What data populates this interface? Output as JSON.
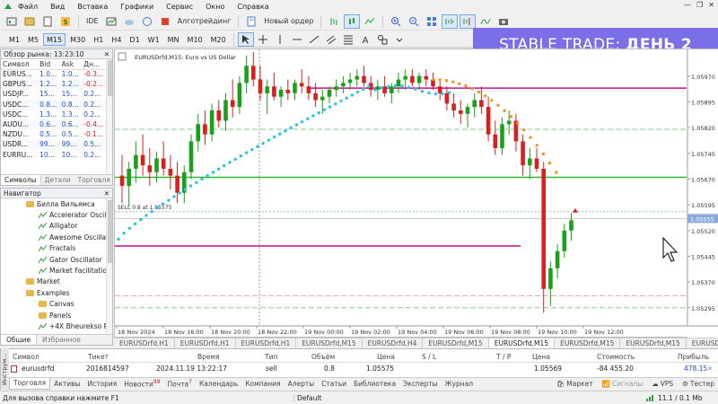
{
  "menu": [
    "Файл",
    "Вид",
    "Вставка",
    "Графики",
    "Сервис",
    "Окно",
    "Справка"
  ],
  "toolbar": {
    "ide": "IDE",
    "algo": "Алготрейдинг",
    "new_order": "Новый ордер"
  },
  "timeframes": [
    "M1",
    "M5",
    "M15",
    "M30",
    "H1",
    "H4",
    "D1",
    "W1",
    "MN",
    "M10",
    "M20"
  ],
  "selected_timeframe": "M15",
  "banner": {
    "prefix": "STABLE TRADE:",
    "bold": "ДЕНЬ 2",
    "bg": "#7a6fe6"
  },
  "market_watch": {
    "title": "Обзор рынка: 13:23:10",
    "headers": [
      "Символ",
      "Bid",
      "Ask",
      "Дн..."
    ],
    "rows": [
      {
        "sym": "EURUS...",
        "bid": "1.0...",
        "ask": "1.0...",
        "chg": "-0.3..."
      },
      {
        "sym": "GBPUS...",
        "bid": "1.2...",
        "ask": "1.2...",
        "chg": "-0.2..."
      },
      {
        "sym": "USDJP...",
        "bid": "15...",
        "ask": "15...",
        "chg": "0.2..."
      },
      {
        "sym": "USDC...",
        "bid": "0.8...",
        "ask": "0.8...",
        "chg": "0.2..."
      },
      {
        "sym": "USDC...",
        "bid": "1.3...",
        "ask": "1.3...",
        "chg": "0.2..."
      },
      {
        "sym": "AUDU...",
        "bid": "0.6...",
        "ask": "0.6...",
        "chg": "-0.4..."
      },
      {
        "sym": "NZDU...",
        "bid": "0.5...",
        "ask": "0.5...",
        "chg": "-0.1..."
      },
      {
        "sym": "USDR...",
        "bid": "99...",
        "ask": "99...",
        "chg": "0.5..."
      },
      {
        "sym": "EURRU...",
        "bid": "10...",
        "ask": "10...",
        "chg": "0.2..."
      }
    ],
    "tabs": [
      "Символы",
      "Детали",
      "Торговля"
    ]
  },
  "navigator": {
    "title": "Навигатор",
    "items": [
      {
        "label": "Билла Вильямса",
        "type": "folder",
        "indent": 28
      },
      {
        "label": "Accelerator Oscill",
        "type": "ind",
        "indent": 42
      },
      {
        "label": "Alligator",
        "type": "ind",
        "indent": 42
      },
      {
        "label": "Awesome Oscillat",
        "type": "ind",
        "indent": 42
      },
      {
        "label": "Fractals",
        "type": "ind",
        "indent": 42
      },
      {
        "label": "Gator Oscillator",
        "type": "ind",
        "indent": 42
      },
      {
        "label": "Market Facilitation",
        "type": "ind",
        "indent": 42
      },
      {
        "label": "Market",
        "type": "folder",
        "indent": 28
      },
      {
        "label": "Examples",
        "type": "folder",
        "indent": 28
      },
      {
        "label": "Canvas",
        "type": "folder",
        "indent": 42
      },
      {
        "label": "Panels",
        "type": "folder",
        "indent": 42
      },
      {
        "label": "+4X Bheurekso P.",
        "type": "ind",
        "indent": 42
      }
    ],
    "tabs": [
      "Общие",
      "Избранное"
    ]
  },
  "chart": {
    "title": "EURUSDrfd,M15: Euro vs US Dollar",
    "sell_label": "SELL 0.8 at 1.05575",
    "price_labels": [
      "1.05970",
      "1.05895",
      "1.05820",
      "1.05745",
      "1.05670",
      "1.05595",
      "1.05520",
      "1.05445",
      "1.05370",
      "1.05295"
    ],
    "current_price": "1.05555",
    "time_labels": [
      "18 Nov 2024",
      "18 Nov 16:00",
      "18 Nov 20:00",
      "18 Nov 22:00",
      "19 Nov 00:00",
      "19 Nov 02:00",
      "19 Nov 04:00",
      "19 Nov 06:00",
      "19 Nov 08:00",
      "19 Nov 10:00",
      "19 Nov 12:00"
    ],
    "colors": {
      "up": "#1aa01a",
      "down": "#d82020",
      "sar": "#2ec1e6",
      "sar_orange": "#f0961e",
      "magenta": "#c0108f",
      "green": "#2fb82f",
      "dashed_green": "#88cc88",
      "dashed_pink": "#e8a0c0"
    }
  },
  "chart_tabs": [
    "EURUSDrfd,H1",
    "EURUSDrfd,H1",
    "EURUSDrfd,H1",
    "EURUSDrfd,M15",
    "EURUSDrfd,H4",
    "EURUSDrfd,M15",
    "EURUSDrfd,M15",
    "EURUSDrfd,M15",
    "EURUSDrfd,M15",
    "EURUSDrfd,M15"
  ],
  "active_chart_tab": 6,
  "trade": {
    "headers": {
      "symbol": "Символ",
      "ticket": "Тикет",
      "time": "Время",
      "type": "Тип",
      "volume": "Объём",
      "price": "Цена",
      "sl": "S / L",
      "tp": "T / P",
      "price2": "Цена",
      "cost": "Стоимость",
      "profit": "Прибыль"
    },
    "row": {
      "symbol": "eurusdrfd",
      "ticket": "2016814597",
      "time": "2024.11.19 13:22:17",
      "type": "sell",
      "volume": "0.8",
      "price": "1.05575",
      "sl": "",
      "tp": "",
      "price2": "1.05569",
      "cost": "-84 455.20",
      "profit": "478.15"
    }
  },
  "toolbox_label": "Инструм...",
  "bottom_tabs": [
    {
      "label": "Торговля",
      "badge": ""
    },
    {
      "label": "Активы",
      "badge": ""
    },
    {
      "label": "История",
      "badge": ""
    },
    {
      "label": "Новости",
      "badge": "99"
    },
    {
      "label": "Почта",
      "badge": "7"
    },
    {
      "label": "Календарь",
      "badge": ""
    },
    {
      "label": "Компания",
      "badge": ""
    },
    {
      "label": "Алерты",
      "badge": ""
    },
    {
      "label": "Статьи",
      "badge": ""
    },
    {
      "label": "Библиотека",
      "badge": ""
    },
    {
      "label": "Эксперты",
      "badge": ""
    },
    {
      "label": "Журнал",
      "badge": ""
    }
  ],
  "bottom_right": {
    "market": "Маркет",
    "signals": "Сигналы",
    "vps": "VPS",
    "tester": "Тестер"
  },
  "status": {
    "help": "Для вызова справки нажмите F1",
    "profile": "Default",
    "traffic": "11.1 / 0.1 Mb"
  }
}
